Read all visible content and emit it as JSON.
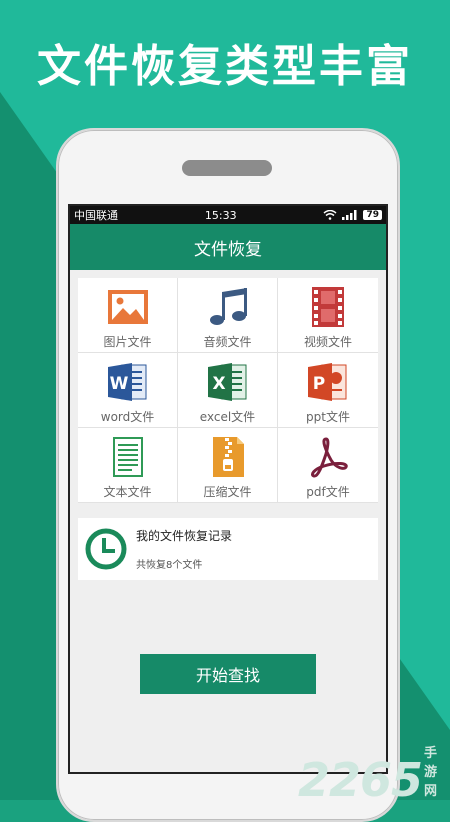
{
  "headline": "文件恢复类型丰富",
  "status_bar": {
    "carrier": "中国联通",
    "time": "15:33",
    "battery": "79"
  },
  "app": {
    "title": "文件恢复"
  },
  "file_types": [
    {
      "label": "图片文件",
      "icon": "image-icon"
    },
    {
      "label": "音频文件",
      "icon": "music-note-icon"
    },
    {
      "label": "视频文件",
      "icon": "film-icon"
    },
    {
      "label": "word文件",
      "icon": "word-icon"
    },
    {
      "label": "excel文件",
      "icon": "excel-icon"
    },
    {
      "label": "ppt文件",
      "icon": "ppt-icon"
    },
    {
      "label": "文本文件",
      "icon": "text-document-icon"
    },
    {
      "label": "压缩文件",
      "icon": "zip-archive-icon"
    },
    {
      "label": "pdf文件",
      "icon": "pdf-icon"
    }
  ],
  "record": {
    "title": "我的文件恢复记录",
    "subtitle": "共恢复8个文件",
    "icon": "clock-icon"
  },
  "start_button": "开始查找",
  "watermark": {
    "number": "2265",
    "text": "手游网"
  },
  "colors": {
    "primary": "#168a68",
    "background": "#20b99a",
    "accent_orange": "#e8773a"
  }
}
